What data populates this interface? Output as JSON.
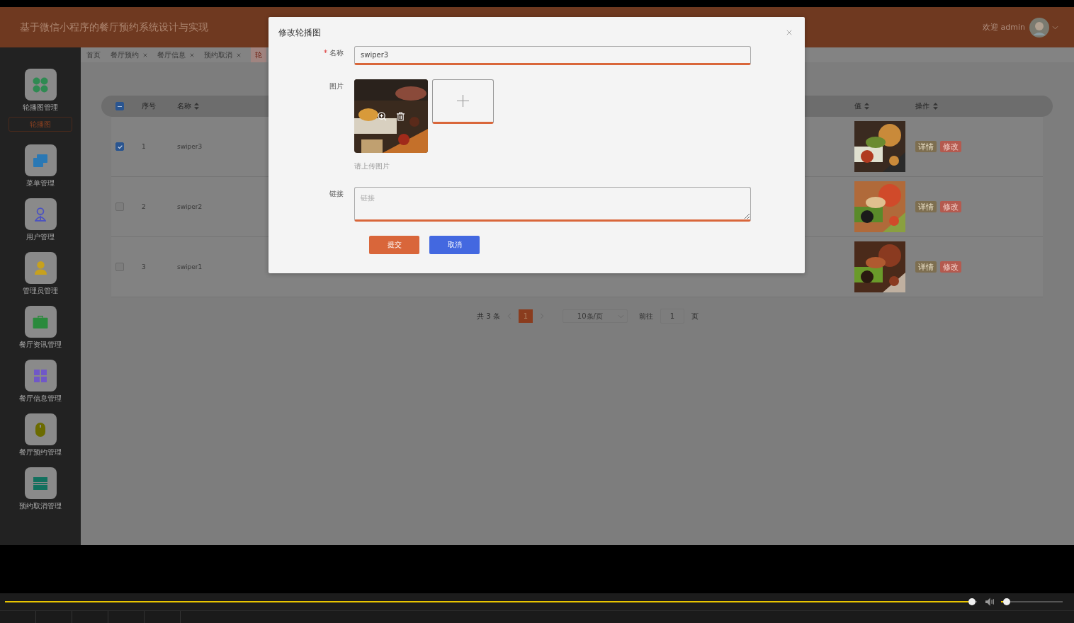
{
  "header": {
    "title": "基于微信小程序的餐厅预约系统设计与实现",
    "welcome": "欢迎 admin"
  },
  "sidebar": {
    "items": [
      {
        "label": "轮播图管理",
        "kind": "dots",
        "color": "#2f8a52",
        "children": [
          {
            "label": "轮播图",
            "selected": true
          }
        ]
      },
      {
        "label": "菜单管理",
        "kind": "folder",
        "color": "#2a78b4"
      },
      {
        "label": "用户管理",
        "kind": "user",
        "color": "#4b52c2"
      },
      {
        "label": "管理员管理",
        "kind": "admin",
        "color": "#c7a11e"
      },
      {
        "label": "餐厅资讯管理",
        "kind": "briefcase",
        "color": "#2a8a3c"
      },
      {
        "label": "餐厅信息管理",
        "kind": "grid",
        "color": "#7058c8"
      },
      {
        "label": "餐厅预约管理",
        "kind": "mouse",
        "color": "#6b6b00"
      },
      {
        "label": "预约取消管理",
        "kind": "list",
        "color": "#12705e"
      }
    ]
  },
  "tabs": [
    {
      "label": "首页",
      "closable": false,
      "selected": false
    },
    {
      "label": "餐厅预约",
      "closable": true,
      "selected": false
    },
    {
      "label": "餐厅信息",
      "closable": true,
      "selected": false
    },
    {
      "label": "预约取消",
      "closable": true,
      "selected": false
    },
    {
      "label": "轮",
      "closable": false,
      "selected": true
    }
  ],
  "table": {
    "columns": [
      {
        "label": "序号",
        "sortable": false
      },
      {
        "label": "名称",
        "sortable": true
      },
      {
        "label": "值",
        "sortable": true
      },
      {
        "label": "操作",
        "sortable": true
      }
    ],
    "header_checkbox": {
      "indeterminate": true
    },
    "rows": [
      {
        "selected": true,
        "index": "1",
        "name": "swiper3",
        "actions": [
          {
            "label": "详情",
            "kind": "detail"
          },
          {
            "label": "修改",
            "kind": "edit"
          }
        ]
      },
      {
        "selected": false,
        "index": "2",
        "name": "swiper2",
        "actions": [
          {
            "label": "详情",
            "kind": "detail"
          },
          {
            "label": "修改",
            "kind": "edit"
          }
        ]
      },
      {
        "selected": false,
        "index": "3",
        "name": "swiper1",
        "actions": [
          {
            "label": "详情",
            "kind": "detail"
          },
          {
            "label": "修改",
            "kind": "edit"
          }
        ]
      }
    ]
  },
  "pagination": {
    "total": "共 3 条",
    "pages": [
      {
        "label": "1",
        "selected": true
      }
    ],
    "page_size": "10条/页",
    "goto_label": "前往",
    "goto_value": "1",
    "page_suffix": "页"
  },
  "modal": {
    "title": "修改轮播图",
    "fields": [
      {
        "kind": "input",
        "label": "名称",
        "required": true,
        "value": "swiper3"
      },
      {
        "kind": "upload",
        "label": "图片",
        "required": false,
        "hint": "请上传图片"
      },
      {
        "kind": "textarea",
        "label": "链接",
        "required": false,
        "placeholder": "链接"
      }
    ],
    "buttons": [
      {
        "label": "提交",
        "kind": "primary"
      },
      {
        "label": "取消",
        "kind": "cancel"
      }
    ]
  },
  "player": {
    "progress": {
      "level": 0.995
    },
    "volume": {
      "level": 0.09
    }
  }
}
